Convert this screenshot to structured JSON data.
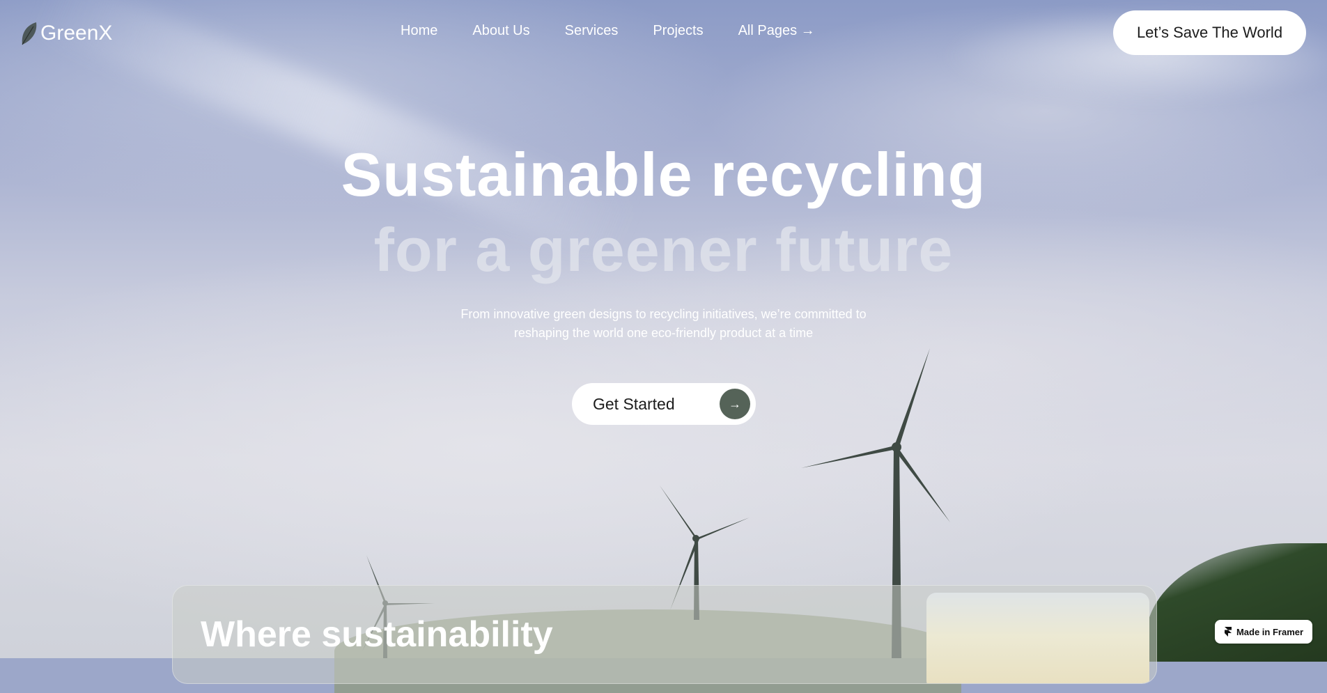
{
  "brand": {
    "name": "GreenX",
    "icon": "leaf-icon"
  },
  "nav": {
    "items": [
      {
        "label": "Home"
      },
      {
        "label": "About Us"
      },
      {
        "label": "Services"
      },
      {
        "label": "Projects"
      },
      {
        "label": "All Pages →"
      }
    ]
  },
  "header_cta": {
    "label": "Let’s Save The World"
  },
  "hero": {
    "headline_line1": "Sustainable recycling",
    "headline_line2": "for a greener future",
    "subtitle_line1": "From innovative green designs to recycling initiatives, we’re committed to",
    "subtitle_line2": "reshaping the world one eco-friendly product at a time",
    "button_label": "Get Started",
    "button_icon": "arrow-right-icon"
  },
  "section": {
    "title": "Where sustainability"
  },
  "badge": {
    "label": "Made in Framer",
    "icon": "framer-icon"
  },
  "colors": {
    "accent": "#556358",
    "white": "#ffffff",
    "text_dark": "#1c1c1c"
  }
}
